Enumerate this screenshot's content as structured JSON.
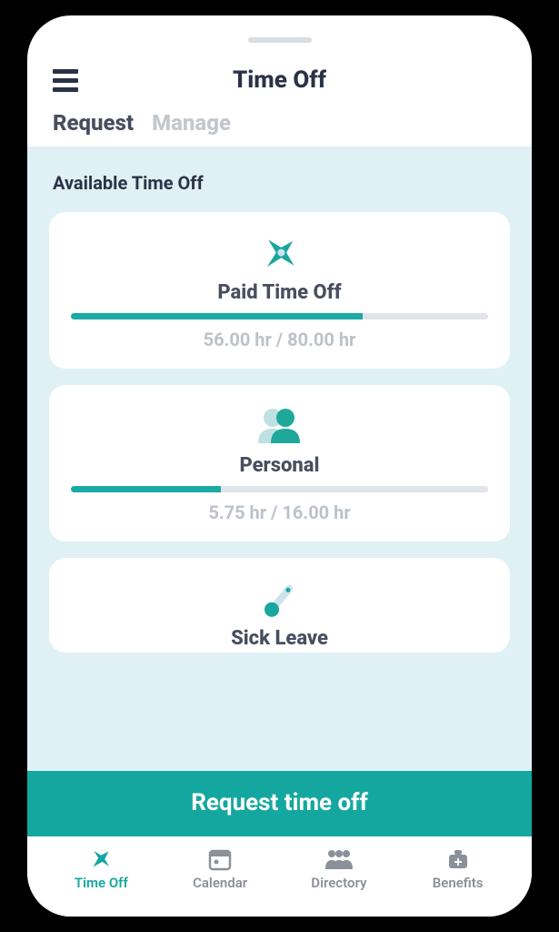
{
  "header": {
    "title": "Time Off"
  },
  "tabs": {
    "request": "Request",
    "manage": "Manage"
  },
  "section_title": "Available Time Off",
  "cards": {
    "pto": {
      "title": "Paid Time Off",
      "hours": "56.00 hr / 80.00 hr",
      "pct": 70
    },
    "personal": {
      "title": "Personal",
      "hours": "5.75 hr / 16.00 hr",
      "pct": 36
    },
    "sick": {
      "title": "Sick Leave"
    }
  },
  "primary_button": "Request time off",
  "nav": {
    "timeoff": "Time Off",
    "calendar": "Calendar",
    "directory": "Directory",
    "benefits": "Benefits"
  },
  "colors": {
    "accent": "#14a79f"
  }
}
